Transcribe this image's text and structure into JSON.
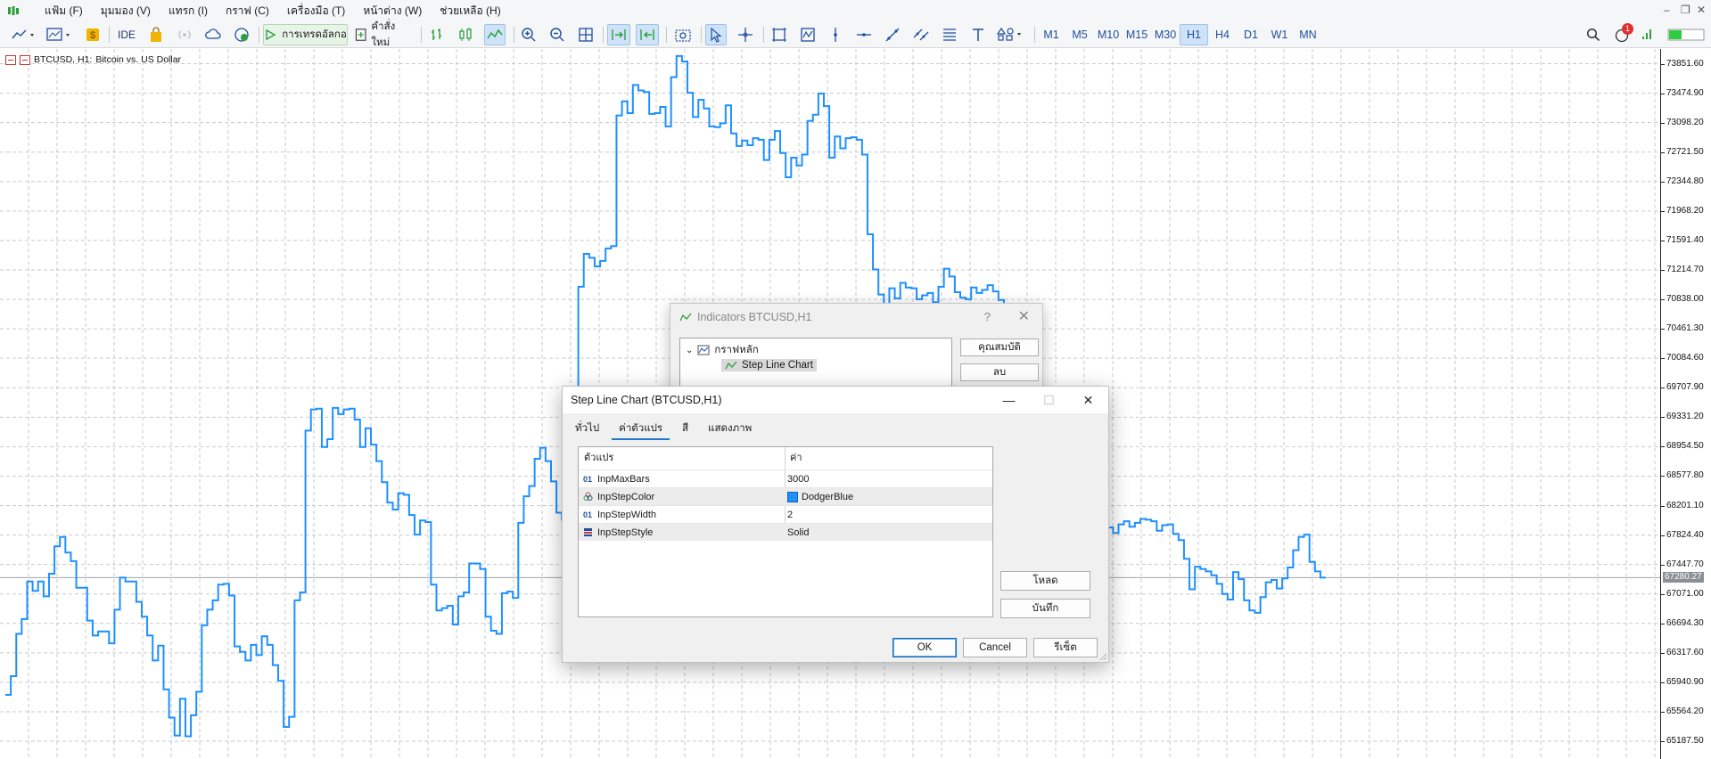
{
  "menu": {
    "items": [
      "แฟ้ม (F)",
      "มุมมอง (V)",
      "แทรก (I)",
      "กราฟ (C)",
      "เครื่องมือ (T)",
      "หน้าต่าง (W)",
      "ช่วยเหลือ (H)"
    ]
  },
  "toolbar": {
    "ide_label": "IDE",
    "algo_label": "การเทรดอัลกอ",
    "new_order_label": "คำสั่งใหม่",
    "notification_count": "1",
    "timeframes": [
      "M1",
      "M5",
      "M10",
      "M15",
      "M30",
      "H1",
      "H4",
      "D1",
      "W1",
      "MN"
    ],
    "active_timeframe": "H1"
  },
  "chart": {
    "symbol": "BTCUSD, H1:",
    "description": "Bitcoin vs. US Dollar",
    "line_color": "#1E90FF",
    "current_price": "67280.27",
    "price_levels": [
      "73851.60",
      "73474.90",
      "73098.20",
      "72721.50",
      "72344.80",
      "71968.20",
      "71591.40",
      "71214.70",
      "70838.00",
      "70461.30",
      "70084.60",
      "69707.90",
      "69331.20",
      "68954.50",
      "68577.80",
      "68201.10",
      "67824.40",
      "67447.70",
      "67071.00",
      "66694.30",
      "66317.60",
      "65940.90",
      "65564.20",
      "65187.50"
    ]
  },
  "chart_data": {
    "type": "line",
    "title": "",
    "xlabel": "",
    "ylabel": "",
    "style": "step",
    "ylim": [
      64960,
      74040
    ],
    "values": [
      65780,
      66020,
      66560,
      66750,
      67230,
      67110,
      67230,
      67040,
      67330,
      67680,
      67800,
      67600,
      67490,
      67150,
      67150,
      66730,
      66540,
      66590,
      66590,
      66440,
      66870,
      67280,
      67230,
      67230,
      66970,
      66780,
      66540,
      66220,
      66410,
      65850,
      65490,
      65260,
      65730,
      65250,
      65520,
      65820,
      66670,
      66870,
      66990,
      67190,
      67200,
      67050,
      66400,
      66330,
      66220,
      66420,
      66290,
      66530,
      66420,
      66160,
      65960,
      65370,
      65500,
      66990,
      67090,
      69160,
      69430,
      69440,
      68950,
      69050,
      69450,
      69370,
      69430,
      69440,
      69300,
      68950,
      69190,
      68980,
      68770,
      68500,
      68240,
      68150,
      68360,
      68340,
      68080,
      67830,
      68010,
      67990,
      67190,
      66860,
      66890,
      66920,
      66680,
      67040,
      67090,
      67460,
      67460,
      67390,
      66780,
      66600,
      66560,
      67080,
      67100,
      67020,
      67980,
      68320,
      68450,
      68800,
      68940,
      68770,
      68510,
      68110,
      68020,
      69100,
      69560,
      71000,
      71420,
      71370,
      71260,
      71330,
      71490,
      71520,
      73190,
      73370,
      73220,
      73580,
      73510,
      73490,
      73210,
      73220,
      73300,
      73050,
      73680,
      73950,
      73880,
      73480,
      73170,
      73390,
      73280,
      73050,
      73040,
      73090,
      73320,
      72960,
      72800,
      72870,
      72810,
      72900,
      72880,
      72620,
      72880,
      72990,
      72710,
      72400,
      72650,
      72550,
      72690,
      73120,
      73200,
      73470,
      73310,
      72650,
      72920,
      72770,
      72900,
      72910,
      72880,
      72690,
      71670,
      71220,
      70900,
      70770,
      70980,
      70850,
      71050,
      70990,
      70980,
      70840,
      70890,
      70920,
      70800,
      71000,
      71230,
      71130,
      70930,
      70860,
      70840,
      70990,
      70920,
      70960,
      71020,
      70940,
      70830,
      70740,
      70750,
      70470,
      70280,
      70120,
      70060,
      69850,
      69660,
      69500,
      69400,
      69280,
      69050,
      68820,
      68500,
      68300,
      68100,
      68050,
      67900,
      67870,
      67920,
      67850,
      67960,
      68000,
      67930,
      67980,
      68030,
      68020,
      68000,
      67880,
      67950,
      67960,
      67840,
      67760,
      67520,
      67130,
      67420,
      67390,
      67360,
      67310,
      67200,
      67070,
      67000,
      67350,
      67260,
      66990,
      66860,
      66830,
      67030,
      67220,
      67250,
      67140,
      67270,
      67410,
      67630,
      67800,
      67830,
      67480,
      67360,
      67280
    ]
  },
  "indicators_dialog": {
    "title": "Indicators BTCUSD,H1",
    "help": "?",
    "root_label": "กราฟหลัก",
    "item_label": "Step Line Chart",
    "properties_button": "คุณสมบัติ",
    "delete_button": "ลบ"
  },
  "step_dialog": {
    "title": "Step Line Chart (BTCUSD,H1)",
    "tabs": [
      "ทั่วไป",
      "ค่าตัวแปร",
      "สี",
      "แสดงภาพ"
    ],
    "active_tab": "ค่าตัวแปร",
    "col_variable": "ตัวแปร",
    "col_value": "ค่า",
    "params": [
      {
        "type_icon": "01",
        "name": "InpMaxBars",
        "value": "3000"
      },
      {
        "type_icon": "color",
        "name": "InpStepColor",
        "value": "DodgerBlue"
      },
      {
        "type_icon": "01",
        "name": "InpStepWidth",
        "value": "2"
      },
      {
        "type_icon": "enum",
        "name": "InpStepStyle",
        "value": "Solid"
      }
    ],
    "load_button": "โหลด",
    "save_button": "บันทึก",
    "ok_button": "OK",
    "cancel_button": "Cancel",
    "reset_button": "รีเซ็ต"
  }
}
